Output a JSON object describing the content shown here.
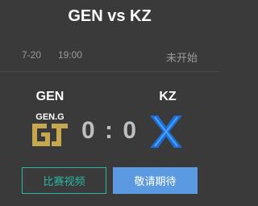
{
  "match": {
    "title": "GEN vs KZ",
    "date": "7-20",
    "time": "19:00",
    "status": "未开始",
    "score": "0 : 0"
  },
  "teams": {
    "left": {
      "name": "GEN",
      "logo_text": "GEN.G",
      "logo_icon": "gen-g-logo-icon"
    },
    "right": {
      "name": "KZ",
      "logo_icon": "kz-logo-icon"
    }
  },
  "buttons": {
    "video_label": "比赛视频",
    "wait_label": "敬请期待"
  },
  "colors": {
    "background": "#3a3a3a",
    "accent_teal": "#2bb7a3",
    "accent_blue": "#5b9ae0",
    "gen_gold": "#c8a84e",
    "kz_blue": "#1f6fd8"
  }
}
